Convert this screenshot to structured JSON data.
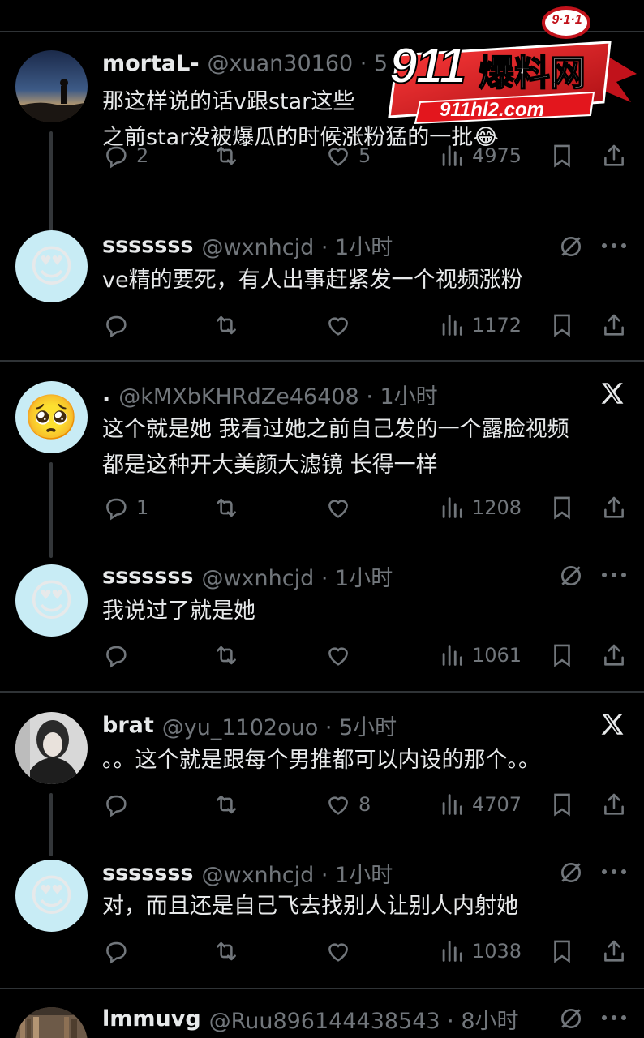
{
  "watermark": {
    "badge": "9·1·1",
    "big": "911",
    "cn": "爆料网",
    "domain": "911hl2.com"
  },
  "tweets": [
    {
      "name": "mortaL-",
      "handle": "@xuan30160 · 5",
      "text_lines": [
        "那这样说的话v跟star这些",
        "之前star没被爆瓜的时候涨粉猛的一批😂"
      ],
      "replies": "2",
      "retweets": "",
      "likes": "5",
      "views": "4975",
      "avatar": "night-sky-photo"
    },
    {
      "name": "sssssss",
      "handle": "@wxnhcjd · 1小时",
      "text_lines": [
        "ve精的要死，有人出事赶紧发一个视频涨粉"
      ],
      "replies": "",
      "retweets": "",
      "likes": "",
      "views": "1172",
      "avatar": "😍"
    },
    {
      "name": ".",
      "handle": "@kMXbKHRdZe46408 · 1小时",
      "text_lines": [
        "这个就是她 我看过她之前自己发的一个露脸视频",
        "都是这种开大美颜大滤镜 长得一样"
      ],
      "replies": "1",
      "retweets": "",
      "likes": "",
      "views": "1208",
      "avatar": "🥺"
    },
    {
      "name": "sssssss",
      "handle": "@wxnhcjd · 1小时",
      "text_lines": [
        "我说过了就是她"
      ],
      "replies": "",
      "retweets": "",
      "likes": "",
      "views": "1061",
      "avatar": "😍"
    },
    {
      "name": "brat",
      "handle": "@yu_1102ouo · 5小时",
      "text_lines": [
        "。。这个就是跟每个男推都可以内设的那个。。"
      ],
      "replies": "",
      "retweets": "",
      "likes": "8",
      "views": "4707",
      "avatar": "photo-person"
    },
    {
      "name": "sssssss",
      "handle": "@wxnhcjd · 1小时",
      "text_lines": [
        "对，而且还是自己飞去找别人让别人内射她"
      ],
      "replies": "",
      "retweets": "",
      "likes": "",
      "views": "1038",
      "avatar": "😍"
    },
    {
      "name": "lmmuvg",
      "handle": "@Ruu896144438543 · 8小时",
      "text_lines": [],
      "replies": "",
      "retweets": "",
      "likes": "",
      "views": "",
      "avatar": "photo-library"
    }
  ],
  "colors": {
    "background": "#000000",
    "text": "#e7e9ea",
    "muted": "#71767b",
    "divider": "#2f3336",
    "watermark_red": "#d7141a"
  },
  "icons": [
    "reply-icon",
    "retweet-icon",
    "like-icon",
    "views-icon",
    "bookmark-icon",
    "share-icon",
    "x-logo-icon",
    "grok-icon",
    "more-icon"
  ]
}
